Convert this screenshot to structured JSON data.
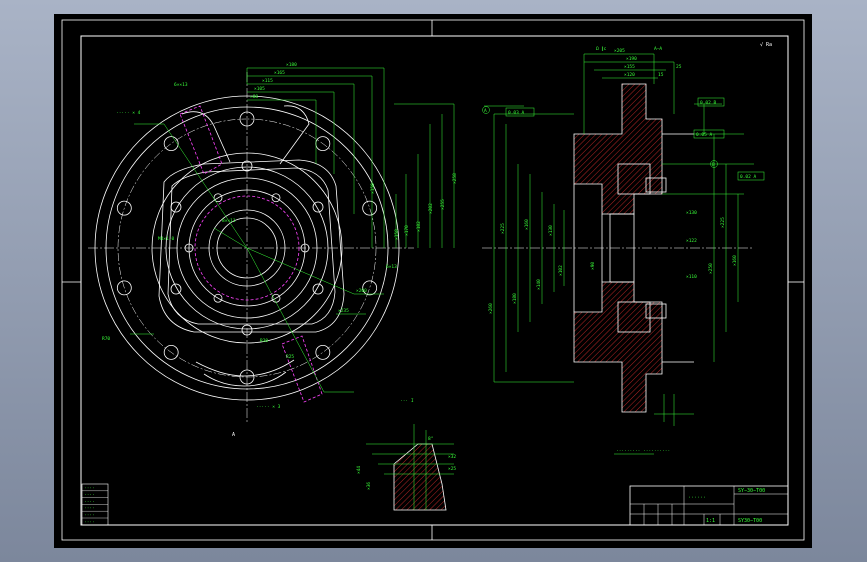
{
  "colors": {
    "background": "#000000",
    "frame": "#ffffff",
    "dimension": "#39ff39",
    "hidden": "#ff44ff",
    "hatch": "#ff3333",
    "ring": "#ff4a4a",
    "centerline": "#ffffff",
    "desktop": "#8a94a8"
  },
  "sheet": {
    "corner_note": "√ Ra",
    "roughness_top": "Ω ∥c"
  },
  "front_view": {
    "dims_top": [
      "×180",
      "×165",
      "×115",
      "×105",
      "×88"
    ],
    "dims_right": [
      "×258",
      "×255",
      "×202",
      "×182",
      "×170",
      "×158",
      "×150"
    ],
    "notes": [
      "M4×1.0",
      "8××11",
      "×200",
      "×235",
      "6×13",
      "R30",
      "R25",
      "R70",
      "6××13"
    ],
    "callouts": [
      "····· × 4",
      "····· × 3"
    ],
    "label_a": "A"
  },
  "section_view": {
    "title": "A–A",
    "dims_top": [
      "×205",
      "×190",
      "×155",
      "×120",
      "15",
      "25"
    ],
    "dims_left": [
      "×260",
      "×225",
      "×180",
      "×160",
      "×140",
      "×130",
      "×102",
      "×90"
    ],
    "dims_right": [
      "×250",
      "×225",
      "×160",
      "×130",
      "×122",
      "×110"
    ],
    "datums": [
      "A",
      "B"
    ],
    "tolerance": [
      "0.03 A",
      "0.02 B",
      "0.05 A",
      "0.02 A"
    ],
    "note": "·········\n··········"
  },
  "detail_view": {
    "title": "··· I",
    "dims": [
      "×44",
      "×36",
      "×32",
      "×25",
      "8°"
    ]
  },
  "title_block": {
    "name": "······",
    "code": "SY−30−T00",
    "scale": "1:1",
    "dwg_no": "SY30−T00"
  },
  "revision_table": {
    "rows": [
      "····",
      "····",
      "····",
      "····",
      "····",
      "····"
    ]
  }
}
